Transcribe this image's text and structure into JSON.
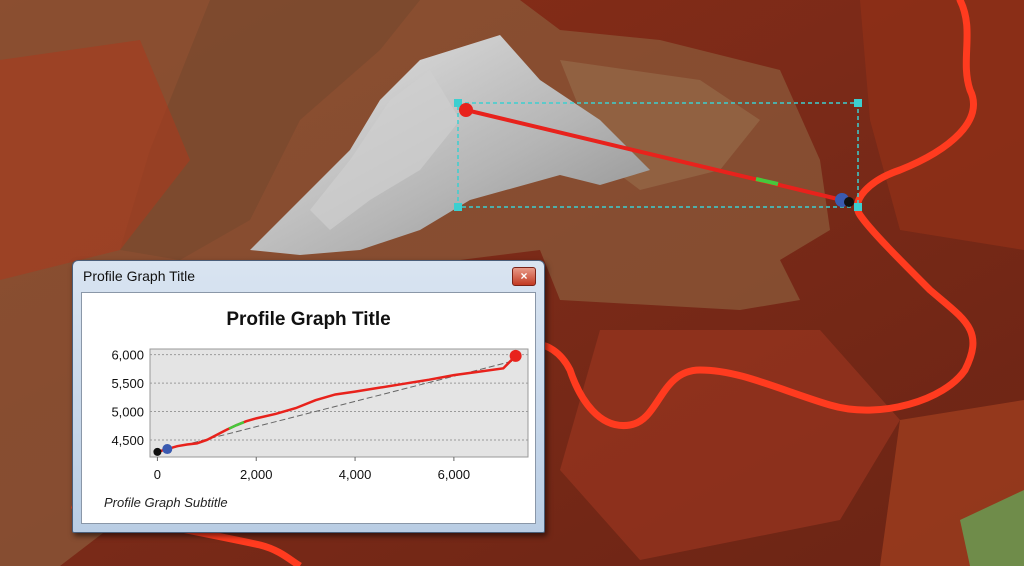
{
  "window": {
    "title": "Profile Graph Title",
    "close_glyph": "×"
  },
  "graph": {
    "title": "Profile Graph Title",
    "subtitle": "Profile Graph Subtitle"
  },
  "colors": {
    "profile_line": "#e8221c",
    "selected_segment": "#46c83c",
    "start_point": "#3a5ab0",
    "end_point": "#e8221c",
    "trend_line": "#666666",
    "plot_bg": "#e4e4e4",
    "selection_box": "#3ccfd0",
    "route": "#ff3b1f"
  },
  "icons": {
    "close": "close-icon",
    "start": "start-point-icon",
    "end": "end-point-icon"
  },
  "chart_data": {
    "type": "line",
    "title": "Profile Graph Title",
    "subtitle": "Profile Graph Subtitle",
    "xlabel": "",
    "ylabel": "",
    "xlim": [
      -150,
      7500
    ],
    "ylim": [
      4200,
      6100
    ],
    "x_ticks": [
      0,
      2000,
      4000,
      6000
    ],
    "x_tick_labels": [
      "0",
      "2,000",
      "4,000",
      "6,000"
    ],
    "y_ticks": [
      4500,
      5000,
      5500,
      6000
    ],
    "y_tick_labels": [
      "4,500",
      "5,000",
      "5,500",
      "6,000"
    ],
    "grid": true,
    "series": [
      {
        "x": [
          0,
          200,
          400,
          600,
          800,
          1000,
          1200,
          1400,
          1600,
          1800,
          2000,
          2400,
          2800,
          3200,
          3600,
          4000,
          4500,
          5000,
          5500,
          6000,
          6500,
          7000,
          7250
        ],
        "y": [
          4290,
          4340,
          4390,
          4420,
          4440,
          4500,
          4590,
          4680,
          4760,
          4830,
          4880,
          4960,
          5060,
          5200,
          5300,
          5350,
          5420,
          5490,
          5560,
          5640,
          5700,
          5760,
          5980
        ]
      }
    ],
    "trend_line": {
      "x": [
        0,
        7250
      ],
      "y": [
        4290,
        5900
      ]
    },
    "selected_range_x": [
      1450,
      1750
    ],
    "start_point": {
      "x": 200,
      "y": 4340
    },
    "end_point": {
      "x": 7250,
      "y": 5980
    }
  }
}
